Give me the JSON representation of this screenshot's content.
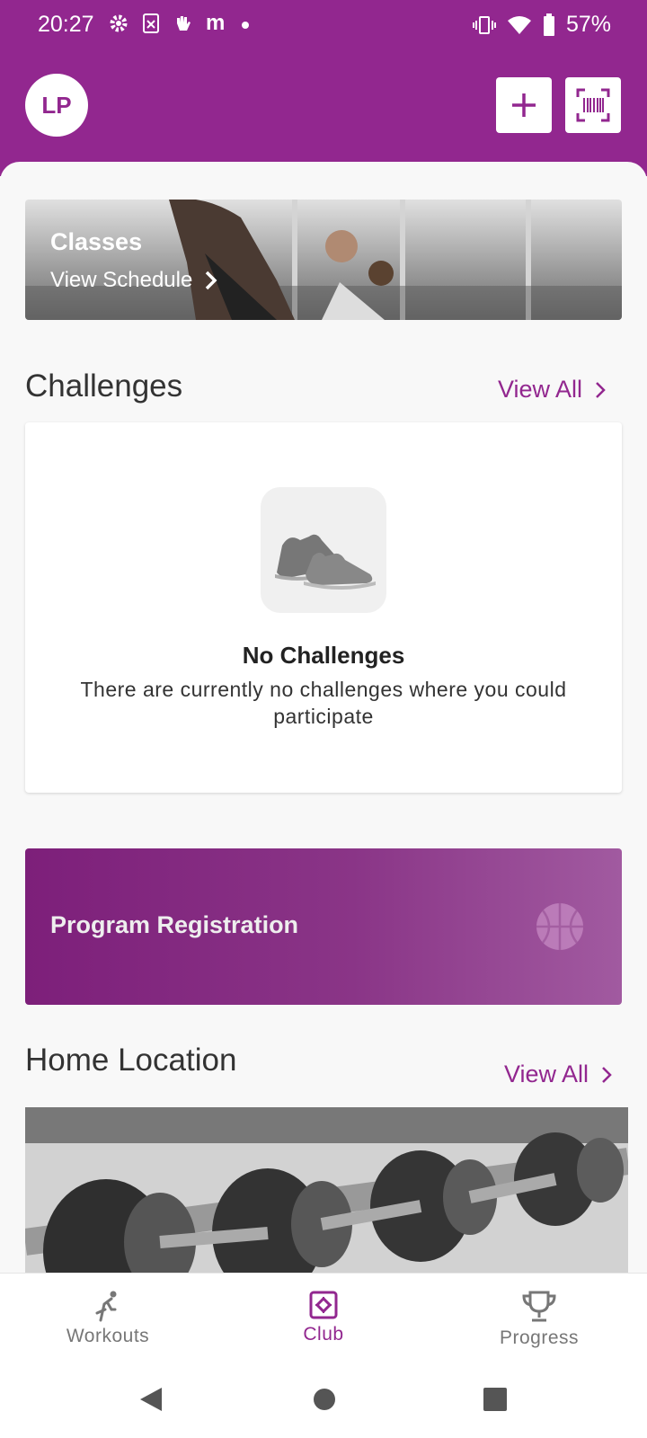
{
  "status_bar": {
    "time": "20:27",
    "battery": "57%"
  },
  "header": {
    "avatar_initials": "LP"
  },
  "classes": {
    "title": "Classes",
    "link": "View Schedule"
  },
  "challenges": {
    "title": "Challenges",
    "view_all": "View All",
    "empty_title": "No Challenges",
    "empty_message": "There are currently no challenges where you could participate"
  },
  "program": {
    "title": "Program Registration"
  },
  "home_location": {
    "title": "Home Location",
    "view_all": "View All"
  },
  "bottom_nav": {
    "items": [
      {
        "label": "Workouts",
        "active": false
      },
      {
        "label": "Club",
        "active": true
      },
      {
        "label": "Progress",
        "active": false
      }
    ]
  },
  "colors": {
    "brand": "#92278f",
    "inactive": "#777777"
  }
}
